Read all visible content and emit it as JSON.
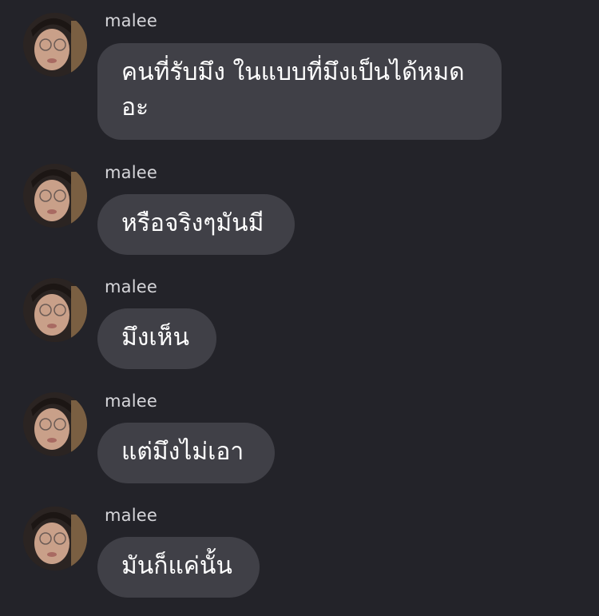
{
  "messages": [
    {
      "sender": "malee",
      "text": "คนที่รับมึง ในแบบที่มึงเป็นได้หมดอะ"
    },
    {
      "sender": "malee",
      "text": "หรือจริงๆมันมี"
    },
    {
      "sender": "malee",
      "text": "มึงเห็น"
    },
    {
      "sender": "malee",
      "text": "แต่มึงไม่เอา"
    },
    {
      "sender": "malee",
      "text": "มันก็แค่นั้น"
    }
  ],
  "colors": {
    "background": "#232329",
    "bubble": "#404047",
    "sender_text": "#d6d6da",
    "message_text": "#ffffff"
  },
  "icons": {
    "avatar": "user-avatar-photo"
  }
}
